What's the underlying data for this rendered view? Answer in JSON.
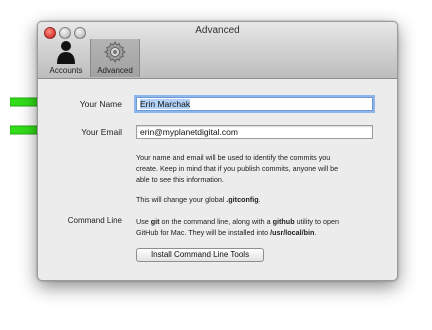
{
  "window": {
    "title": "Advanced"
  },
  "toolbar": {
    "items": [
      {
        "label": "Accounts",
        "icon": "person-silhouette-icon"
      },
      {
        "label": "Advanced",
        "icon": "gear-icon",
        "selected": true
      }
    ]
  },
  "form": {
    "name_label": "Your Name",
    "name_value": "Erin Marchak",
    "email_label": "Your Email",
    "email_value": "erin@myplanetdigital.com",
    "help_text": {
      "line1": "Your name and email will be used to identify the commits you",
      "line2": "create. Keep in mind that if you publish commits, anyone will be",
      "line3": "able to see this information.",
      "gitconfig_prefix": "This will change your global ",
      "gitconfig_name": ".gitconfig",
      "gitconfig_suffix": "."
    }
  },
  "command_line": {
    "label": "Command Line",
    "text": {
      "p1": "Use ",
      "git": "git",
      "p2": " on the command line, along with a ",
      "github": "github",
      "p3": " utility to open",
      "p4": "GitHub for Mac. They will be installed into ",
      "path": "/usr/local/bin",
      "p5": "."
    },
    "install_button": "Install Command Line Tools"
  },
  "annotations": {
    "arrow_color": "#33dd1a"
  }
}
